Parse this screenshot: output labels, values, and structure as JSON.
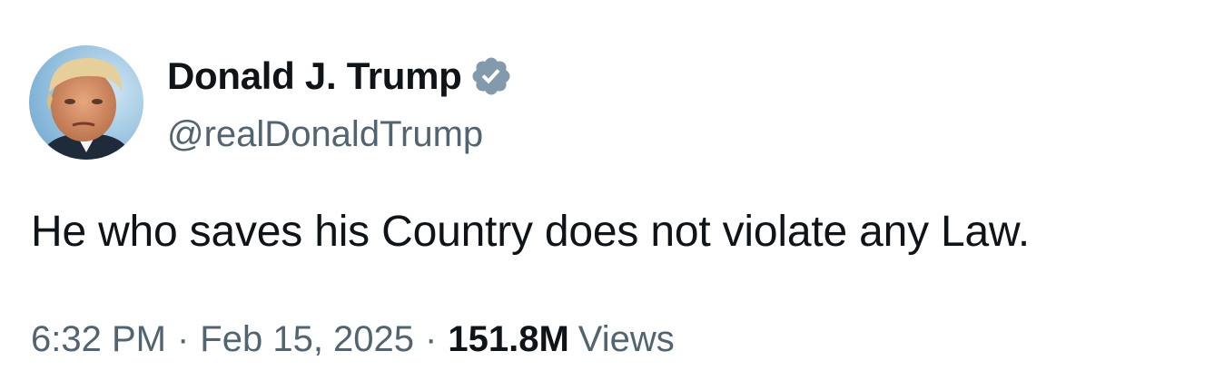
{
  "author": {
    "display_name": "Donald J. Trump",
    "handle": "@realDonaldTrump",
    "verified_icon": "verified-badge-icon",
    "verified_color": "#829aab"
  },
  "tweet": {
    "text": "He who saves his Country does not violate any Law."
  },
  "meta": {
    "time": "6:32 PM",
    "separator": "·",
    "date": "Feb 15, 2025",
    "views_count": "151.8M",
    "views_label": "Views"
  }
}
